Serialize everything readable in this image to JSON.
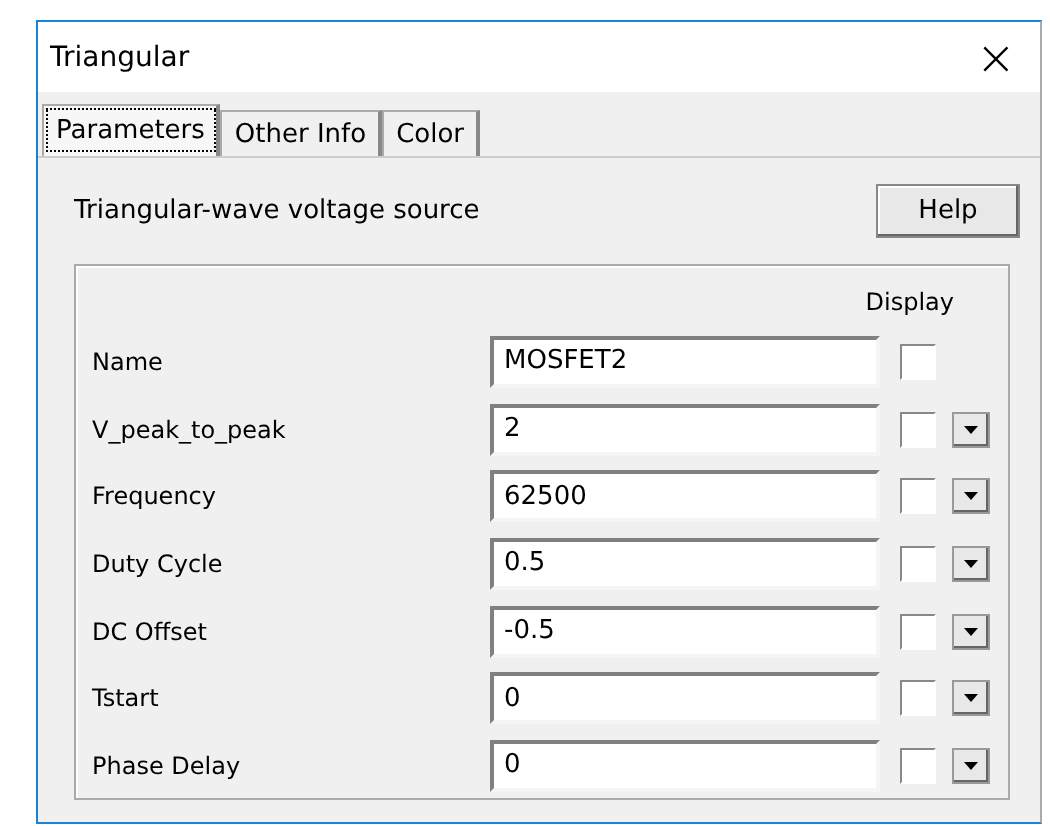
{
  "window": {
    "title": "Triangular",
    "close": "×"
  },
  "tabs": [
    {
      "label": "Parameters",
      "selected": true
    },
    {
      "label": "Other Info",
      "selected": false
    },
    {
      "label": "Color",
      "selected": false
    }
  ],
  "description": "Triangular-wave voltage source",
  "help_button": "Help",
  "display_heading": "Display",
  "rows": [
    {
      "label": "Name",
      "value": "MOSFET2",
      "display": false,
      "dropdown": false
    },
    {
      "label": "V_peak_to_peak",
      "value": "2",
      "display": false,
      "dropdown": true
    },
    {
      "label": "Frequency",
      "value": "62500",
      "display": false,
      "dropdown": true
    },
    {
      "label": "Duty Cycle",
      "value": "0.5",
      "display": false,
      "dropdown": true
    },
    {
      "label": "DC Offset",
      "value": "-0.5",
      "display": false,
      "dropdown": true
    },
    {
      "label": "Tstart",
      "value": "0",
      "display": false,
      "dropdown": true
    },
    {
      "label": "Phase Delay",
      "value": "0",
      "display": false,
      "dropdown": true
    }
  ]
}
